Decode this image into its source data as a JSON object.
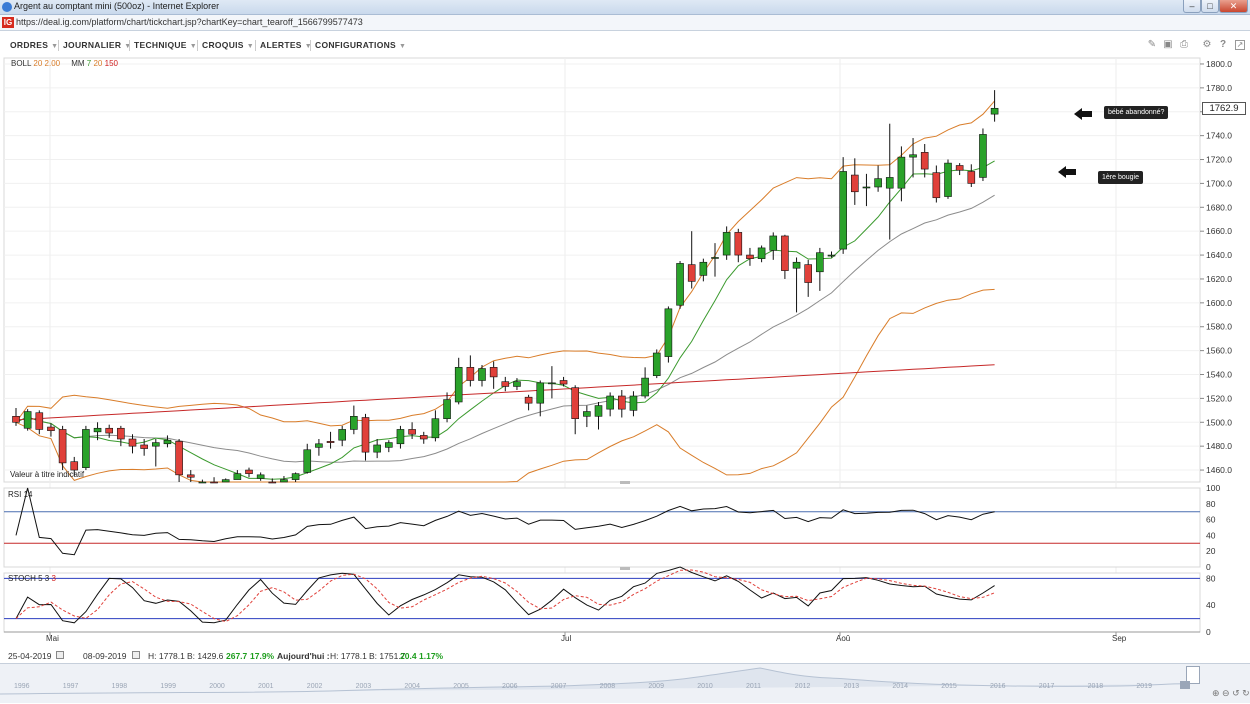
{
  "window": {
    "title": "Argent au comptant mini (500oz) - Internet Explorer",
    "url": "https://deal.ig.com/platform/chart/tickchart.jsp?chartKey=chart_tearoff_1566799577473",
    "logo": "IG"
  },
  "menu": {
    "items": [
      "ORDRES",
      "JOURNALIER",
      "TECHNIQUE",
      "CROQUIS",
      "ALERTES",
      "CONFIGURATIONS"
    ],
    "tool_icons": [
      "ruler-icon",
      "image-icon",
      "print-icon",
      "gear-icon",
      "help-icon",
      "expand-icon"
    ]
  },
  "indicators": {
    "boll_label": "BOLL",
    "boll_params": "20 2.00",
    "mm_label": "MM",
    "mm_p1": "7",
    "mm_p2": "20",
    "mm_p3": "150",
    "rsi_label": "RSI",
    "rsi_param": "14",
    "stoch_label": "STOCH",
    "stoch_p1": "5",
    "stoch_p2": "3",
    "stoch_p3": "3"
  },
  "note": "Valeur à titre indicatif",
  "last_price": "1762.9",
  "annotations": {
    "first": "bébé abandonné?",
    "second": "1ère bougie"
  },
  "status": {
    "from": "25-04-2019",
    "to": "08-09-2019",
    "high": "H: 1778.1",
    "low": "B: 1429.6",
    "chg": "267.7",
    "chg_pct": "17.9%",
    "today_label": "Aujourd'hui :",
    "today_high": "H: 1778.1",
    "today_low": "B: 1751.7",
    "today_chg": "20.4",
    "today_pct": "1.17%"
  },
  "navigator": {
    "years": [
      "1996",
      "1997",
      "1998",
      "1999",
      "2000",
      "2001",
      "2002",
      "2003",
      "2004",
      "2005",
      "2006",
      "2007",
      "2008",
      "2009",
      "2010",
      "2011",
      "2012",
      "2013",
      "2014",
      "2015",
      "2016",
      "2017",
      "2018",
      "2019"
    ]
  },
  "colors": {
    "up": "#2aa22a",
    "down": "#e0403a",
    "boll": "#d97d2a",
    "mm7": "#3b9a2e",
    "mm20": "#8c8c8c",
    "mm150": "#c62828",
    "rsi_hi": "#4a6fb0",
    "rsi_lo": "#c62828",
    "stoch_band": "#2b3ec0"
  },
  "chart_data": {
    "type": "candlestick",
    "y_axis": {
      "min": 1450,
      "max": 1800,
      "ticks": [
        1460,
        1480,
        1500,
        1520,
        1540,
        1560,
        1580,
        1600,
        1620,
        1640,
        1660,
        1680,
        1700,
        1720,
        1740,
        1760,
        1780,
        1800
      ]
    },
    "x_labels": [
      "Mai",
      "Jul",
      "Aoû",
      "Sep"
    ],
    "candles": [
      {
        "o": 1505,
        "c": 1500,
        "h": 1512,
        "l": 1497
      },
      {
        "o": 1495,
        "c": 1509,
        "h": 1511,
        "l": 1493
      },
      {
        "o": 1508,
        "c": 1494,
        "h": 1510,
        "l": 1490
      },
      {
        "o": 1496,
        "c": 1493,
        "h": 1499,
        "l": 1488
      },
      {
        "o": 1494,
        "c": 1466,
        "h": 1497,
        "l": 1460
      },
      {
        "o": 1467,
        "c": 1460,
        "h": 1471,
        "l": 1455
      },
      {
        "o": 1462,
        "c": 1494,
        "h": 1497,
        "l": 1460
      },
      {
        "o": 1492,
        "c": 1495,
        "h": 1500,
        "l": 1485
      },
      {
        "o": 1495,
        "c": 1491,
        "h": 1498,
        "l": 1487
      },
      {
        "o": 1495,
        "c": 1486,
        "h": 1497,
        "l": 1480
      },
      {
        "o": 1486,
        "c": 1480,
        "h": 1490,
        "l": 1474
      },
      {
        "o": 1481,
        "c": 1478,
        "h": 1486,
        "l": 1472
      },
      {
        "o": 1480,
        "c": 1483,
        "h": 1486,
        "l": 1463
      },
      {
        "o": 1482,
        "c": 1485,
        "h": 1489,
        "l": 1479
      },
      {
        "o": 1484,
        "c": 1456,
        "h": 1486,
        "l": 1450
      },
      {
        "o": 1456,
        "c": 1454,
        "h": 1460,
        "l": 1448
      },
      {
        "o": 1448,
        "c": 1449,
        "h": 1452,
        "l": 1442
      },
      {
        "o": 1450,
        "c": 1446,
        "h": 1454,
        "l": 1440
      },
      {
        "o": 1447,
        "c": 1452,
        "h": 1453,
        "l": 1445
      },
      {
        "o": 1452,
        "c": 1457,
        "h": 1460,
        "l": 1453
      },
      {
        "o": 1460,
        "c": 1457,
        "h": 1462,
        "l": 1454
      },
      {
        "o": 1453,
        "c": 1456,
        "h": 1458,
        "l": 1451
      },
      {
        "o": 1450,
        "c": 1449,
        "h": 1453,
        "l": 1447
      },
      {
        "o": 1449,
        "c": 1452,
        "h": 1455,
        "l": 1447
      },
      {
        "o": 1452,
        "c": 1457,
        "h": 1458,
        "l": 1450
      },
      {
        "o": 1458,
        "c": 1477,
        "h": 1482,
        "l": 1457
      },
      {
        "o": 1479,
        "c": 1482,
        "h": 1486,
        "l": 1472
      },
      {
        "o": 1484,
        "c": 1483,
        "h": 1492,
        "l": 1478
      },
      {
        "o": 1485,
        "c": 1494,
        "h": 1497,
        "l": 1480
      },
      {
        "o": 1494,
        "c": 1505,
        "h": 1514,
        "l": 1490
      },
      {
        "o": 1504,
        "c": 1475,
        "h": 1507,
        "l": 1468
      },
      {
        "o": 1475,
        "c": 1481,
        "h": 1486,
        "l": 1470
      },
      {
        "o": 1479,
        "c": 1483,
        "h": 1485,
        "l": 1475
      },
      {
        "o": 1482,
        "c": 1494,
        "h": 1497,
        "l": 1478
      },
      {
        "o": 1494,
        "c": 1490,
        "h": 1500,
        "l": 1486
      },
      {
        "o": 1489,
        "c": 1486,
        "h": 1492,
        "l": 1482
      },
      {
        "o": 1487,
        "c": 1503,
        "h": 1510,
        "l": 1484
      },
      {
        "o": 1503,
        "c": 1519,
        "h": 1525,
        "l": 1500
      },
      {
        "o": 1517,
        "c": 1546,
        "h": 1554,
        "l": 1515
      },
      {
        "o": 1546,
        "c": 1535,
        "h": 1556,
        "l": 1530
      },
      {
        "o": 1535,
        "c": 1545,
        "h": 1548,
        "l": 1530
      },
      {
        "o": 1546,
        "c": 1538,
        "h": 1551,
        "l": 1528
      },
      {
        "o": 1534,
        "c": 1530,
        "h": 1538,
        "l": 1526
      },
      {
        "o": 1530,
        "c": 1534,
        "h": 1537,
        "l": 1527
      },
      {
        "o": 1521,
        "c": 1516,
        "h": 1523,
        "l": 1510
      },
      {
        "o": 1516,
        "c": 1533,
        "h": 1535,
        "l": 1505
      },
      {
        "o": 1533,
        "c": 1533,
        "h": 1547,
        "l": 1520
      },
      {
        "o": 1535,
        "c": 1532,
        "h": 1538,
        "l": 1530
      },
      {
        "o": 1529,
        "c": 1503,
        "h": 1531,
        "l": 1490
      },
      {
        "o": 1505,
        "c": 1509,
        "h": 1514,
        "l": 1496
      },
      {
        "o": 1505,
        "c": 1514,
        "h": 1517,
        "l": 1494
      },
      {
        "o": 1511,
        "c": 1522,
        "h": 1525,
        "l": 1505
      },
      {
        "o": 1522,
        "c": 1511,
        "h": 1527,
        "l": 1504
      },
      {
        "o": 1510,
        "c": 1522,
        "h": 1526,
        "l": 1505
      },
      {
        "o": 1522,
        "c": 1537,
        "h": 1546,
        "l": 1520
      },
      {
        "o": 1539,
        "c": 1558,
        "h": 1561,
        "l": 1537
      },
      {
        "o": 1555,
        "c": 1595,
        "h": 1597,
        "l": 1550
      },
      {
        "o": 1598,
        "c": 1633,
        "h": 1635,
        "l": 1595
      },
      {
        "o": 1632,
        "c": 1618,
        "h": 1660,
        "l": 1612
      },
      {
        "o": 1623,
        "c": 1634,
        "h": 1637,
        "l": 1618
      },
      {
        "o": 1638,
        "c": 1638,
        "h": 1650,
        "l": 1622
      },
      {
        "o": 1640,
        "c": 1659,
        "h": 1664,
        "l": 1636
      },
      {
        "o": 1659,
        "c": 1640,
        "h": 1662,
        "l": 1634
      },
      {
        "o": 1640,
        "c": 1637,
        "h": 1646,
        "l": 1631
      },
      {
        "o": 1637,
        "c": 1646,
        "h": 1648,
        "l": 1634
      },
      {
        "o": 1644,
        "c": 1656,
        "h": 1659,
        "l": 1636
      },
      {
        "o": 1656,
        "c": 1627,
        "h": 1657,
        "l": 1620
      },
      {
        "o": 1629,
        "c": 1634,
        "h": 1638,
        "l": 1592
      },
      {
        "o": 1632,
        "c": 1617,
        "h": 1636,
        "l": 1605
      },
      {
        "o": 1626,
        "c": 1642,
        "h": 1646,
        "l": 1610
      },
      {
        "o": 1640,
        "c": 1640,
        "h": 1643,
        "l": 1638
      },
      {
        "o": 1645,
        "c": 1710,
        "h": 1722,
        "l": 1641
      },
      {
        "o": 1707,
        "c": 1693,
        "h": 1721,
        "l": 1682
      },
      {
        "o": 1697,
        "c": 1697,
        "h": 1708,
        "l": 1681
      },
      {
        "o": 1697,
        "c": 1704,
        "h": 1715,
        "l": 1693
      },
      {
        "o": 1696,
        "c": 1705,
        "h": 1750,
        "l": 1653
      },
      {
        "o": 1696,
        "c": 1722,
        "h": 1731,
        "l": 1685
      },
      {
        "o": 1722,
        "c": 1724,
        "h": 1738,
        "l": 1705
      },
      {
        "o": 1726,
        "c": 1712,
        "h": 1733,
        "l": 1705
      },
      {
        "o": 1709,
        "c": 1688,
        "h": 1715,
        "l": 1684
      },
      {
        "o": 1689,
        "c": 1717,
        "h": 1720,
        "l": 1687
      },
      {
        "o": 1715,
        "c": 1711,
        "h": 1717,
        "l": 1707
      },
      {
        "o": 1710,
        "c": 1700,
        "h": 1716,
        "l": 1697
      },
      {
        "o": 1705,
        "c": 1741,
        "h": 1746,
        "l": 1702
      },
      {
        "o": 1758,
        "c": 1762.9,
        "h": 1778.1,
        "l": 1751.7
      }
    ],
    "rsi_axis": [
      0,
      20,
      40,
      60,
      80,
      100
    ],
    "rsi_levels": [
      70,
      30
    ],
    "stoch_axis": [
      0,
      40,
      80
    ],
    "stoch_levels": [
      80,
      20
    ]
  }
}
